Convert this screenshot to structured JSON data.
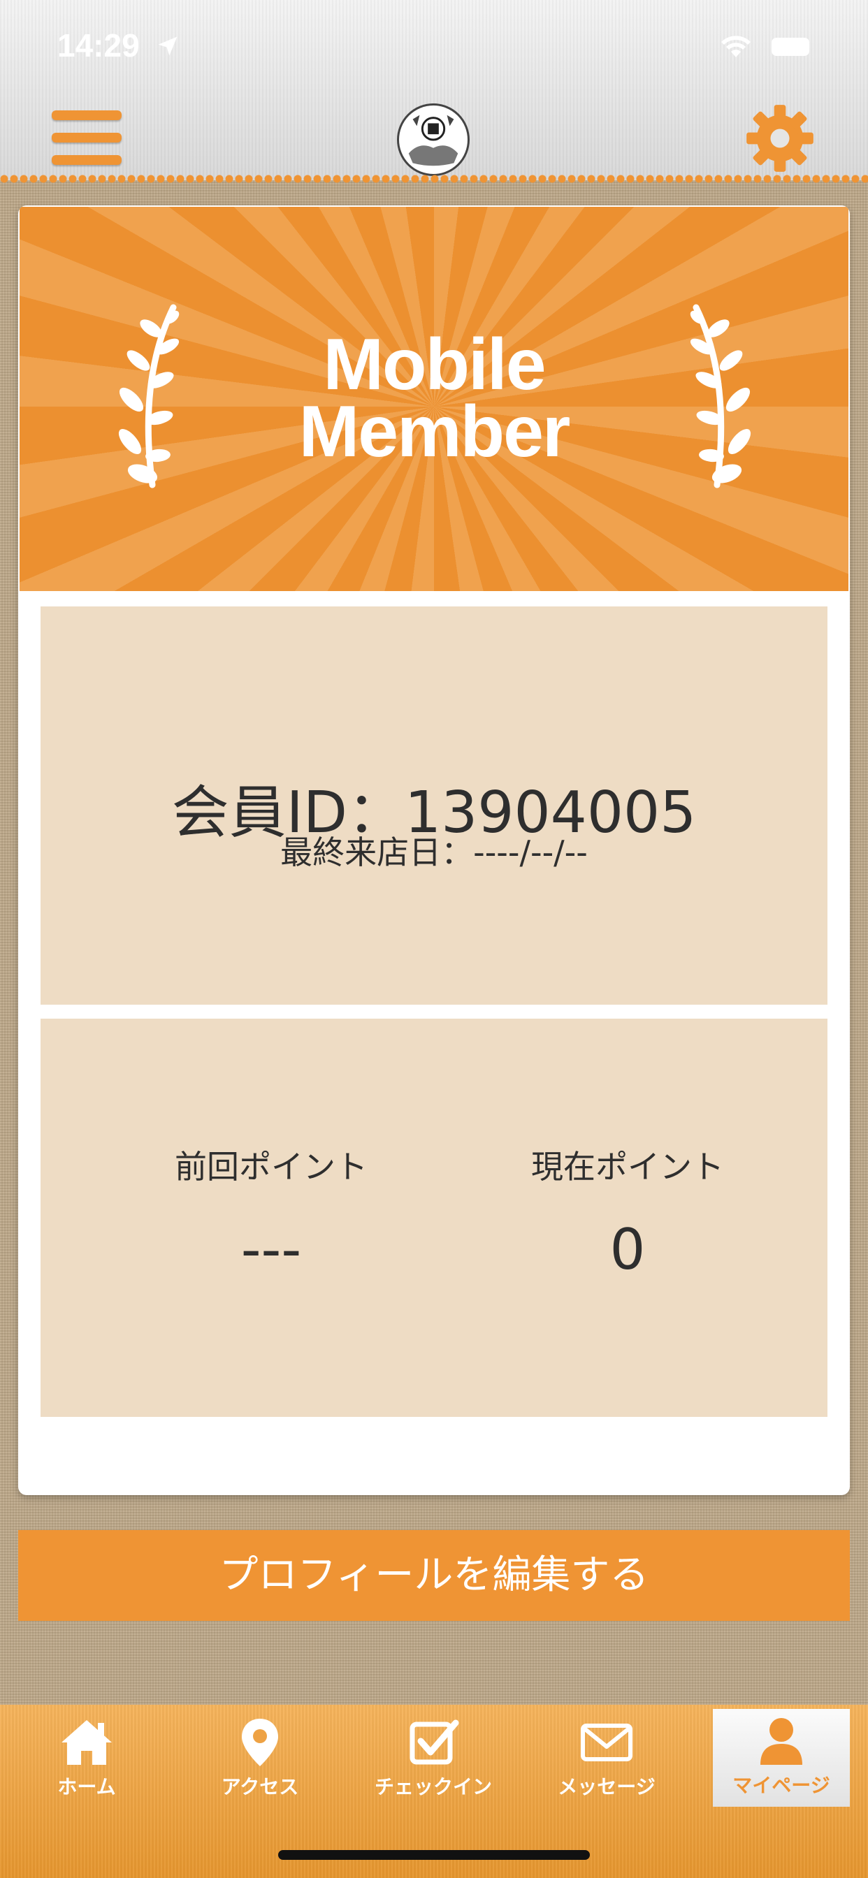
{
  "status_bar": {
    "time": "14:29"
  },
  "colors": {
    "accent": "#ef9434",
    "panel": "#eedcc4",
    "text": "#2e2e2e"
  },
  "header": {
    "menu_icon": "hamburger-icon",
    "logo_icon": "store-seal-logo",
    "settings_icon": "gear-icon"
  },
  "banner": {
    "line1": "Mobile",
    "line2": "Member"
  },
  "member": {
    "id_text": "会員ID：13904005",
    "last_visit_text": "最終来店日：----/--/--"
  },
  "points": {
    "previous": {
      "label": "前回ポイント",
      "value": "---"
    },
    "current": {
      "label": "現在ポイント",
      "value": "0"
    }
  },
  "edit_profile_label": "プロフィールを編集する",
  "tabs": [
    {
      "label": "ホーム",
      "icon": "home-icon"
    },
    {
      "label": "アクセス",
      "icon": "map-pin-icon"
    },
    {
      "label": "チェックイン",
      "icon": "checkbox-icon"
    },
    {
      "label": "メッセージ",
      "icon": "envelope-icon"
    },
    {
      "label": "マイページ",
      "icon": "user-icon",
      "active": true
    }
  ]
}
